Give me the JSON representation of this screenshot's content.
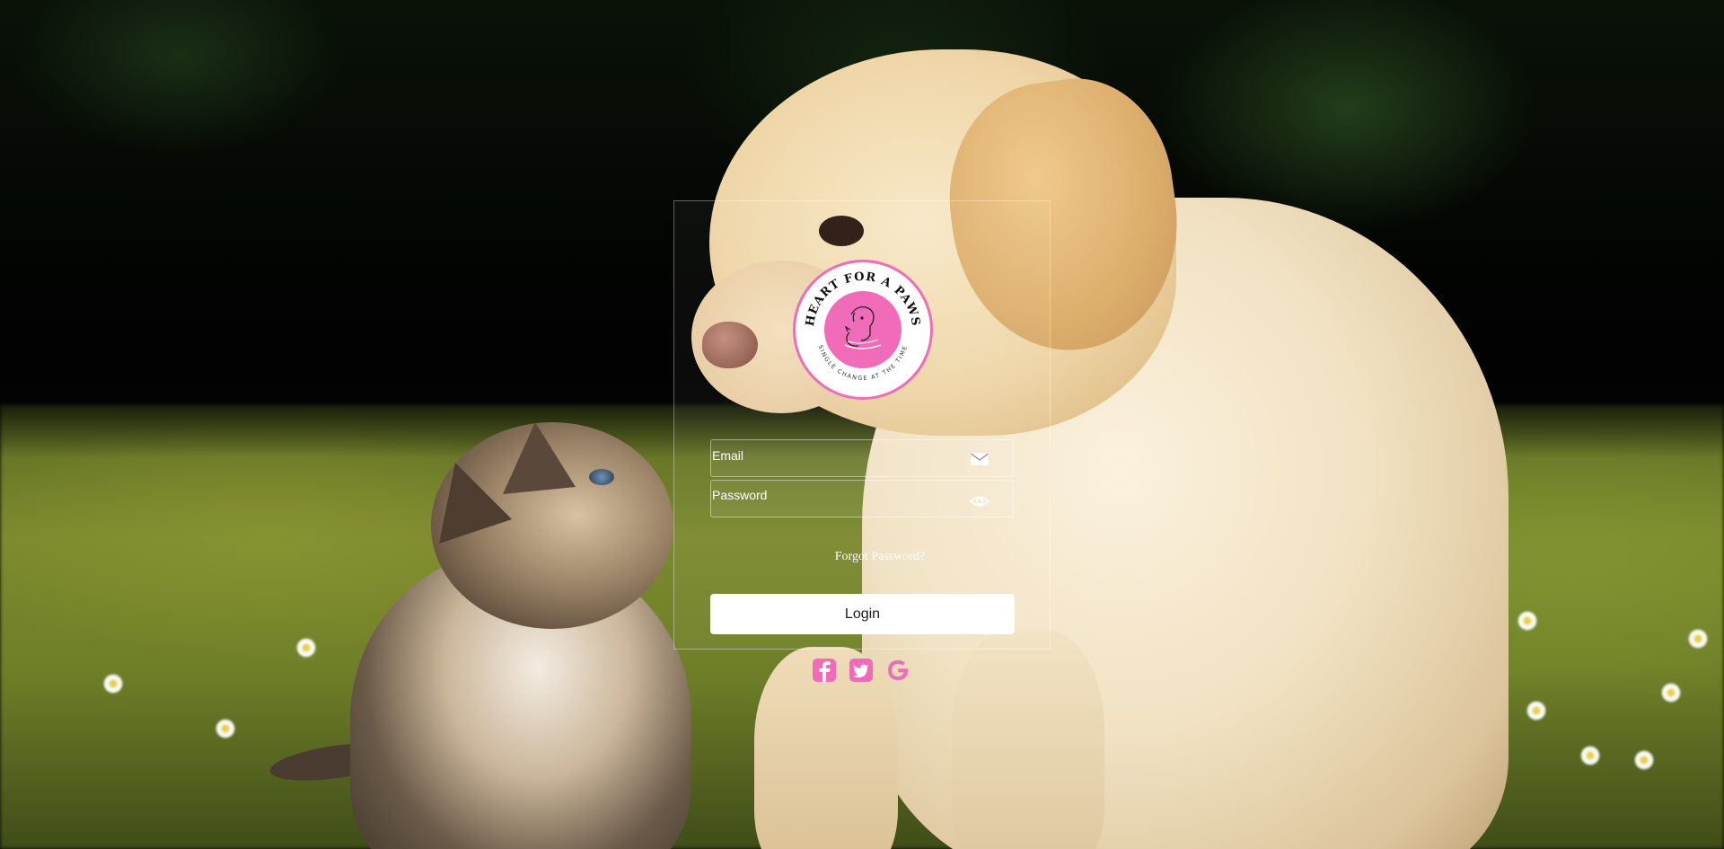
{
  "logo": {
    "alt": "Heart For A Paws logo",
    "ring_text_top": "HEART FOR A PAWS",
    "ring_text_bottom": "SINGLE CHANGE AT THE TIME",
    "accent_color": "#f06cb8"
  },
  "form": {
    "email_placeholder": "Email",
    "email_icon": "envelope-icon",
    "password_placeholder": "Password",
    "password_icon": "eye-icon",
    "forgot_label": "Forgot Password?",
    "login_label": "Login"
  },
  "social": {
    "icon_color": "#f06cb8",
    "items": [
      {
        "name": "facebook-icon"
      },
      {
        "name": "twitter-icon"
      },
      {
        "name": "google-icon"
      }
    ]
  }
}
